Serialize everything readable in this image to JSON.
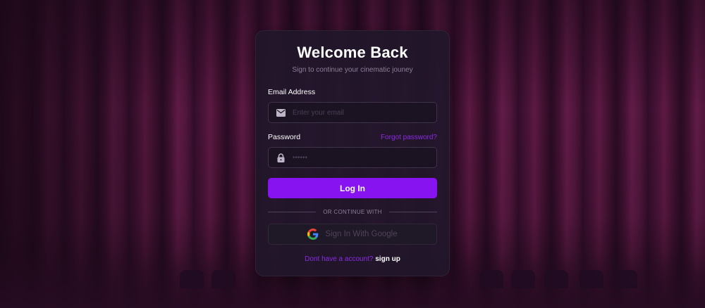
{
  "login": {
    "title": "Welcome Back",
    "subtitle": "Sign to continue your cinematic jouney",
    "email_label": "Email Address",
    "email_placeholder": "Enter your email",
    "password_label": "Password",
    "password_placeholder": "••••••",
    "forgot_label": "Forgot password?",
    "login_button": "Log In",
    "divider_text": "OR CONTINUE WITH",
    "google_button": "Sign In With Google",
    "footer_text": "Dont have a account?",
    "signup_link": "sign up"
  },
  "icons": {
    "email": "mail-icon",
    "password": "lock-icon",
    "google": "google-icon"
  },
  "colors": {
    "accent": "#8613f0",
    "link": "#8a2be2",
    "card_bg": "#21162a",
    "background": "#4a1436"
  }
}
